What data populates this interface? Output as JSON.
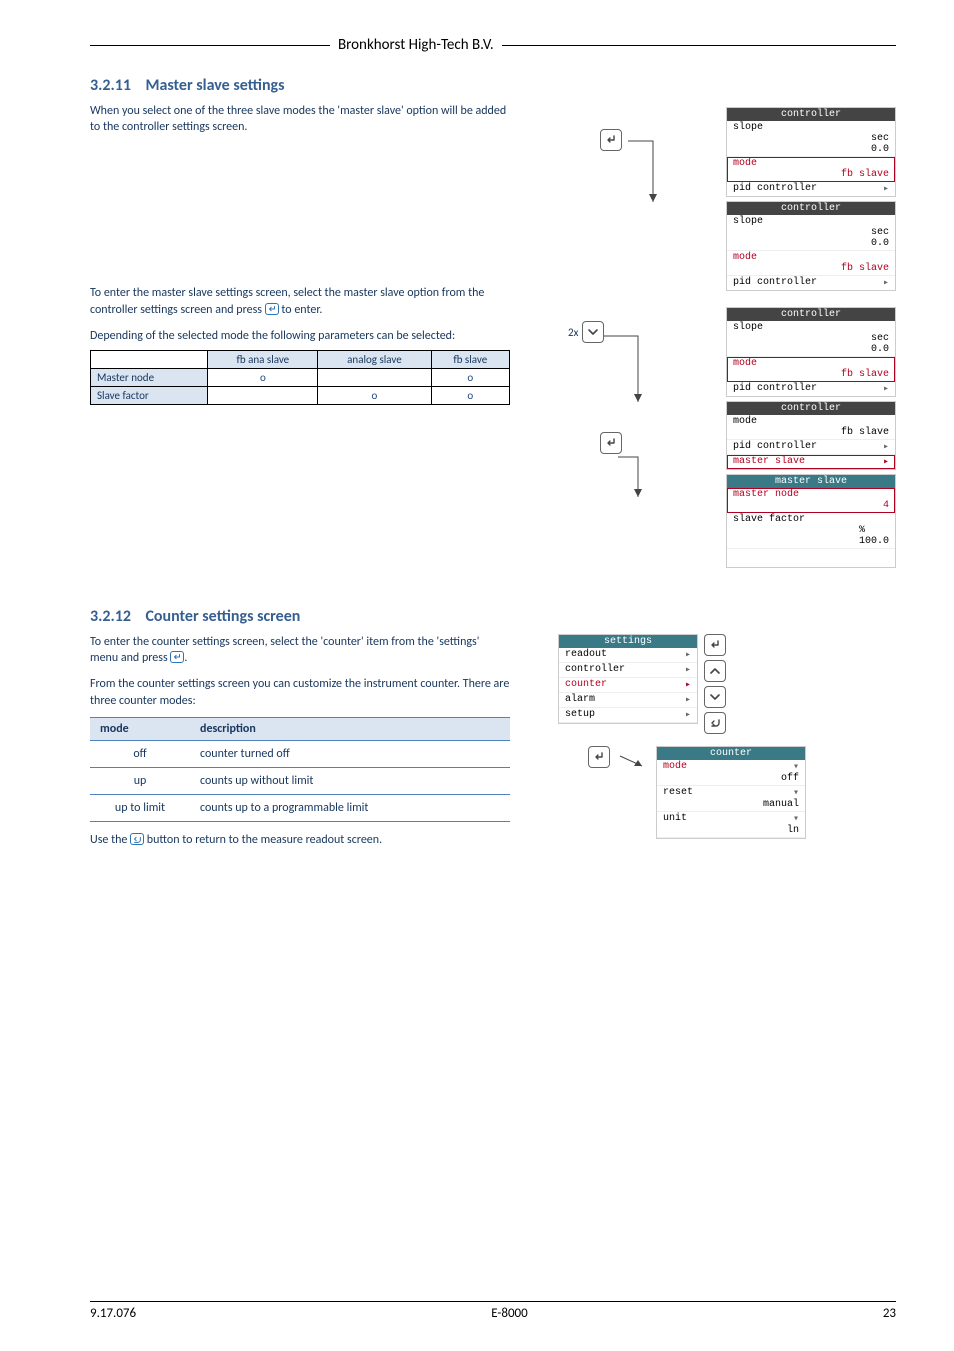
{
  "company": "Bronkhorst High-Tech B.V.",
  "footer": {
    "left": "9.17.076",
    "center": "E-8000",
    "right": "23"
  },
  "sec1": {
    "num": "3.2.11",
    "title": "Master slave settings",
    "p1": "When you select one of the three slave modes the 'master slave' option will be added to the controller settings screen.",
    "p2a": "To enter the master slave settings screen, select the master slave option from the controller settings screen and press ",
    "p2b": " to enter.",
    "p3": "Depending of the selected mode the following parameters can be selected:",
    "table": {
      "headers": [
        "",
        "fb ana slave",
        "analog slave",
        "fb slave"
      ],
      "rows": [
        {
          "label": "Master node",
          "cells": [
            "o",
            "",
            "o"
          ]
        },
        {
          "label": "Slave factor",
          "cells": [
            "",
            "o",
            "o"
          ]
        }
      ]
    },
    "panels1": {
      "p1": {
        "title": "controller",
        "rows": [
          {
            "l": "slope",
            "r": "sec",
            "r2": "0.0"
          },
          {
            "l": "mode",
            "r": "",
            "r2": "fb slave",
            "hl": true
          },
          {
            "l": "pid controller",
            "r": "▸"
          }
        ]
      },
      "p2": {
        "title": "controller",
        "rows": [
          {
            "l": "slope",
            "r": "sec",
            "r2": "0.0"
          },
          {
            "l": "mode",
            "r": "",
            "r2": "fb slave",
            "hl": true
          },
          {
            "l": "pid controller",
            "r": "▸"
          }
        ]
      }
    },
    "panels2": {
      "note2x": "2x",
      "p1": {
        "title": "controller",
        "rows": [
          {
            "l": "slope",
            "r": "sec",
            "r2": "0.0"
          },
          {
            "l": "mode",
            "r": "",
            "r2": "fb slave",
            "hl": true
          },
          {
            "l": "pid controller",
            "r": "▸"
          }
        ]
      },
      "p2": {
        "title": "controller",
        "rows": [
          {
            "l": "mode",
            "r": "",
            "r2": "fb slave"
          },
          {
            "l": "pid controller",
            "r": "▸"
          },
          {
            "l": "master slave",
            "r": "▸",
            "hl": true
          }
        ]
      },
      "p3": {
        "title": "master slave",
        "rows": [
          {
            "l": "master node",
            "r": "",
            "r2": "4",
            "hl": true
          },
          {
            "l": "slave factor",
            "r": "%",
            "r2": "100.0"
          }
        ]
      }
    }
  },
  "sec2": {
    "num": "3.2.12",
    "title": "Counter settings screen",
    "p1a": "To enter the counter settings screen, select the 'counter' item from the 'settings' menu and press ",
    "p1b": ".",
    "p2": "From the counter settings screen you can customize the instrument counter. There are three counter modes:",
    "table": {
      "headers": [
        "mode",
        "description"
      ],
      "rows": [
        [
          "off",
          "counter turned off"
        ],
        [
          "up",
          "counts up without limit"
        ],
        [
          "up to limit",
          "counts up to a programmable limit"
        ]
      ]
    },
    "p3a": "Use the ",
    "p3b": " button to return to the measure readout screen.",
    "settingsPanel": {
      "title": "settings",
      "rows": [
        {
          "l": "readout",
          "r": "▸"
        },
        {
          "l": "controller",
          "r": "▸"
        },
        {
          "l": "counter",
          "r": "▸",
          "hl": true
        },
        {
          "l": "alarm",
          "r": "▸"
        },
        {
          "l": "setup",
          "r": "▸"
        }
      ]
    },
    "counterPanel": {
      "title": "counter",
      "rows": [
        {
          "l": "mode",
          "r2": "off",
          "hl": true
        },
        {
          "l": "reset",
          "r2": "manual"
        },
        {
          "l": "unit",
          "r2": "ln"
        }
      ]
    }
  }
}
